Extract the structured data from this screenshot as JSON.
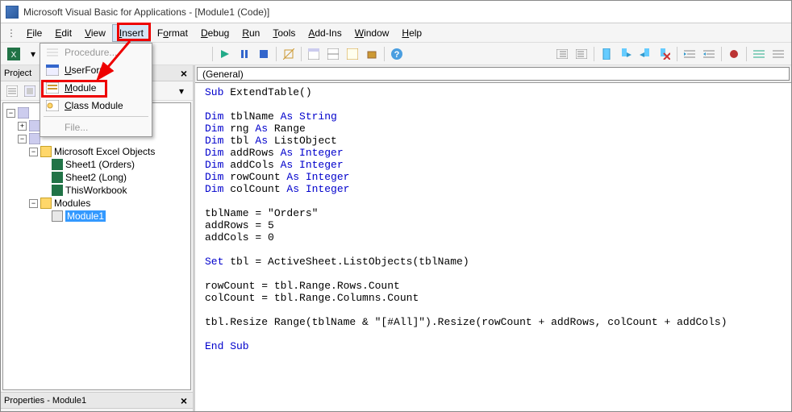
{
  "title": "Microsoft Visual Basic for Applications - [Module1 (Code)]",
  "menu": {
    "file": "File",
    "edit": "Edit",
    "view": "View",
    "insert": "Insert",
    "format": "Format",
    "debug": "Debug",
    "run": "Run",
    "tools": "Tools",
    "addins": "Add-Ins",
    "window": "Window",
    "help": "Help"
  },
  "insert_menu": {
    "procedure": "Procedure...",
    "userform": "UserForm",
    "module": "Module",
    "class_module": "Class Module",
    "file": "File..."
  },
  "project_panel": {
    "title": "Project",
    "tree": {
      "excel_objects": "Microsoft Excel Objects",
      "sheet1": "Sheet1 (Orders)",
      "sheet2": "Sheet2 (Long)",
      "thisworkbook": "ThisWorkbook",
      "modules": "Modules",
      "module1": "Module1"
    }
  },
  "properties_panel": {
    "title": "Properties - Module1"
  },
  "code_dropdown": "(General)",
  "code_lines": [
    {
      "t": "k",
      "v": "Sub"
    },
    {
      "t": "p",
      "v": " ExtendTable()"
    },
    {
      "t": "br"
    },
    {
      "t": "br"
    },
    {
      "t": "k",
      "v": "Dim"
    },
    {
      "t": "p",
      "v": " tblName "
    },
    {
      "t": "k",
      "v": "As String"
    },
    {
      "t": "br"
    },
    {
      "t": "k",
      "v": "Dim"
    },
    {
      "t": "p",
      "v": " rng "
    },
    {
      "t": "k",
      "v": "As"
    },
    {
      "t": "p",
      "v": " Range"
    },
    {
      "t": "br"
    },
    {
      "t": "k",
      "v": "Dim"
    },
    {
      "t": "p",
      "v": " tbl "
    },
    {
      "t": "k",
      "v": "As"
    },
    {
      "t": "p",
      "v": " ListObject"
    },
    {
      "t": "br"
    },
    {
      "t": "k",
      "v": "Dim"
    },
    {
      "t": "p",
      "v": " addRows "
    },
    {
      "t": "k",
      "v": "As Integer"
    },
    {
      "t": "br"
    },
    {
      "t": "k",
      "v": "Dim"
    },
    {
      "t": "p",
      "v": " addCols "
    },
    {
      "t": "k",
      "v": "As Integer"
    },
    {
      "t": "br"
    },
    {
      "t": "k",
      "v": "Dim"
    },
    {
      "t": "p",
      "v": " rowCount "
    },
    {
      "t": "k",
      "v": "As Integer"
    },
    {
      "t": "br"
    },
    {
      "t": "k",
      "v": "Dim"
    },
    {
      "t": "p",
      "v": " colCount "
    },
    {
      "t": "k",
      "v": "As Integer"
    },
    {
      "t": "br"
    },
    {
      "t": "br"
    },
    {
      "t": "p",
      "v": "tblName = \"Orders\""
    },
    {
      "t": "br"
    },
    {
      "t": "p",
      "v": "addRows = 5"
    },
    {
      "t": "br"
    },
    {
      "t": "p",
      "v": "addCols = 0"
    },
    {
      "t": "br"
    },
    {
      "t": "br"
    },
    {
      "t": "k",
      "v": "Set"
    },
    {
      "t": "p",
      "v": " tbl = ActiveSheet.ListObjects(tblName)"
    },
    {
      "t": "br"
    },
    {
      "t": "br"
    },
    {
      "t": "p",
      "v": "rowCount = tbl.Range.Rows.Count"
    },
    {
      "t": "br"
    },
    {
      "t": "p",
      "v": "colCount = tbl.Range.Columns.Count"
    },
    {
      "t": "br"
    },
    {
      "t": "br"
    },
    {
      "t": "p",
      "v": "tbl.Resize Range(tblName & \"[#All]\").Resize(rowCount + addRows, colCount + addCols)"
    },
    {
      "t": "br"
    },
    {
      "t": "br"
    },
    {
      "t": "k",
      "v": "End Sub"
    }
  ]
}
